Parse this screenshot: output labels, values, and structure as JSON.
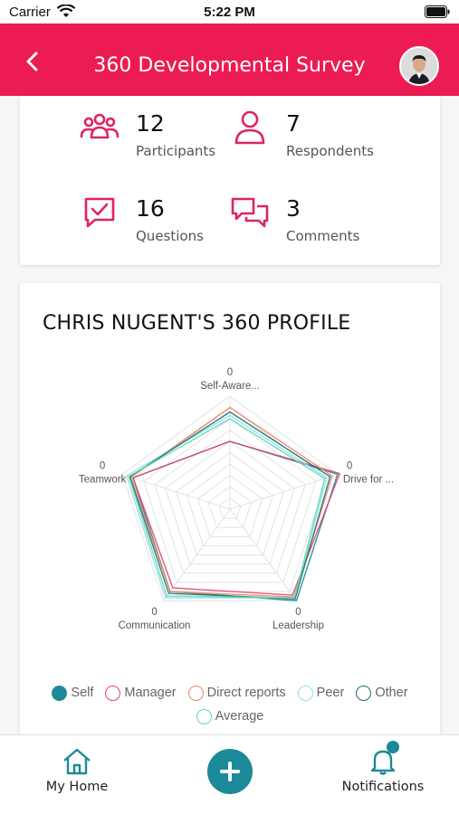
{
  "status_bar": {
    "carrier": "Carrier",
    "time": "5:22 PM"
  },
  "header": {
    "title": "360 Developmental Survey"
  },
  "stats": [
    {
      "value": "12",
      "label": "Participants",
      "icon": "group-icon"
    },
    {
      "value": "7",
      "label": "Respondents",
      "icon": "person-icon"
    },
    {
      "value": "16",
      "label": "Questions",
      "icon": "checked-chat-icon"
    },
    {
      "value": "3",
      "label": "Comments",
      "icon": "chat-bubbles-icon"
    }
  ],
  "profile": {
    "title": "CHRIS NUGENT'S 360 PROFILE"
  },
  "chart_data": {
    "type": "radar",
    "axes": [
      {
        "label": "Self-Aware...",
        "value_label": "0"
      },
      {
        "label": "Drive for ...",
        "value_label": "0"
      },
      {
        "label": "Leadership",
        "value_label": "0"
      },
      {
        "label": "Communication",
        "value_label": "0"
      },
      {
        "label": "Teamwork",
        "value_label": "0"
      }
    ],
    "rmax": 1,
    "grid_levels": 10,
    "series": [
      {
        "name": "Self",
        "color": "#1c8a99",
        "values": [
          0.6,
          1.0,
          1.0,
          0.9,
          0.9
        ]
      },
      {
        "name": "Manager",
        "color": "#e8416b",
        "values": [
          0.6,
          1.02,
          0.94,
          0.86,
          0.9
        ]
      },
      {
        "name": "Direct reports",
        "color": "#f0845f",
        "values": [
          0.9,
          0.95,
          0.96,
          0.9,
          0.92
        ]
      },
      {
        "name": "Peer",
        "color": "#8ee0ee",
        "values": [
          0.83,
          0.9,
          0.97,
          0.97,
          0.96
        ]
      },
      {
        "name": "Other",
        "color": "#1f6d73",
        "values": [
          0.86,
          0.93,
          0.98,
          0.92,
          0.93
        ]
      },
      {
        "name": "Average",
        "color": "#5fdcb3",
        "values": [
          0.8,
          0.88,
          0.97,
          0.95,
          0.94
        ]
      }
    ]
  },
  "legend": {
    "row1": [
      "Self",
      "Manager",
      "Direct reports",
      "Peer",
      "Other"
    ],
    "row2": [
      "Average"
    ]
  },
  "tabbar": {
    "home_label": "My Home",
    "notifications_label": "Notifications"
  },
  "colors": {
    "brand": "#ec1b54",
    "accent": "#1c8a99"
  }
}
